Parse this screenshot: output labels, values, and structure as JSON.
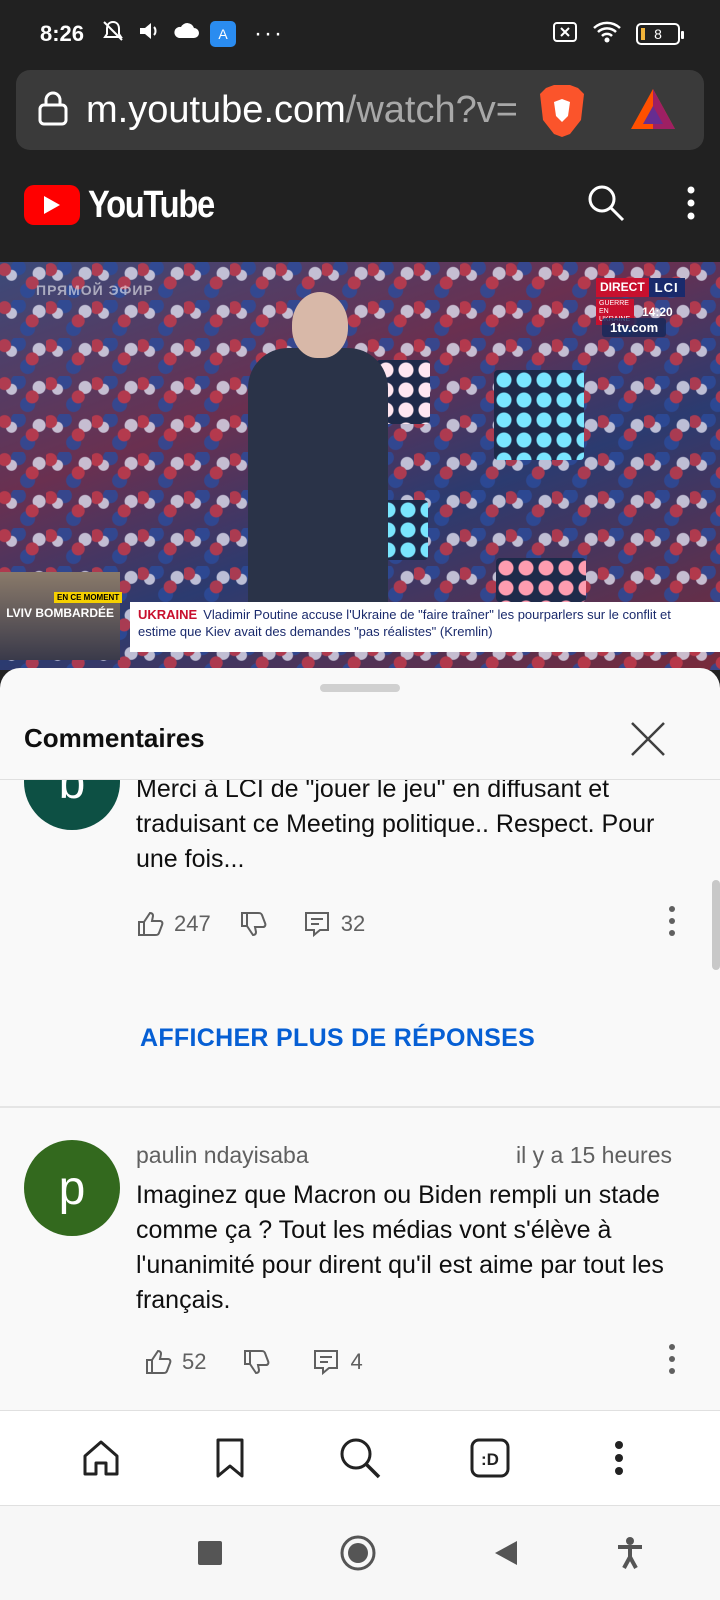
{
  "status_bar": {
    "time": "8:26",
    "app_badge": "A",
    "more": "···",
    "battery": "8"
  },
  "address_bar": {
    "host": "m.youtube.com",
    "path": "/watch?v="
  },
  "youtube": {
    "wordmark": "YouTube"
  },
  "video": {
    "watermark": "ПРЯМОЙ ЭФИР",
    "lci_direct": "DIRECT",
    "lci_logo": "LCI",
    "lci_tag": "GUERRE EN UKRAINE",
    "lci_time": "14:20",
    "site": "1tv.com",
    "moment_tag": "EN CE MOMENT",
    "place": "LVIV BOMBARDÉE",
    "banner_label": "UKRAINE",
    "banner_text": "Vladimir Poutine accuse l'Ukraine de \"faire traîner\" les pourparlers sur le conflit et estime que Kiev avait des demandes \"pas réalistes\" (Kremlin)"
  },
  "comments_panel": {
    "title": "Commentaires",
    "show_more_replies": "AFFICHER PLUS DE RÉPONSES",
    "comments": [
      {
        "avatar_letter": "b",
        "avatar_color": "#0d5044",
        "text": "Merci à LCI de \"jouer le jeu\" en diffusant et traduisant ce Meeting politique.. Respect. Pour une fois...",
        "likes": "247",
        "replies": "32"
      },
      {
        "author": "paulin ndayisaba",
        "time": "il y a 15 heures",
        "avatar_letter": "p",
        "avatar_color": "#33691e",
        "text": "Imaginez que Macron ou Biden rempli un stade comme ça ? Tout les médias vont s'élève à l'unanimité pour dirent qu'il est aime par tout les français.",
        "likes": "52",
        "replies": "4"
      }
    ]
  },
  "browser_toolbar": {
    "tabs_label": ":D"
  },
  "icons": {
    "status": [
      "notifications-off-icon",
      "volume-icon",
      "cloud-icon",
      "app-notification-icon",
      "battery-icon",
      "wifi-icon",
      "no-sim-icon"
    ],
    "toolbar": [
      "home-icon",
      "bookmark-icon",
      "search-icon",
      "tabs-icon",
      "menu-icon"
    ],
    "system": [
      "recents-icon",
      "home-circle-icon",
      "back-icon",
      "accessibility-icon"
    ]
  }
}
